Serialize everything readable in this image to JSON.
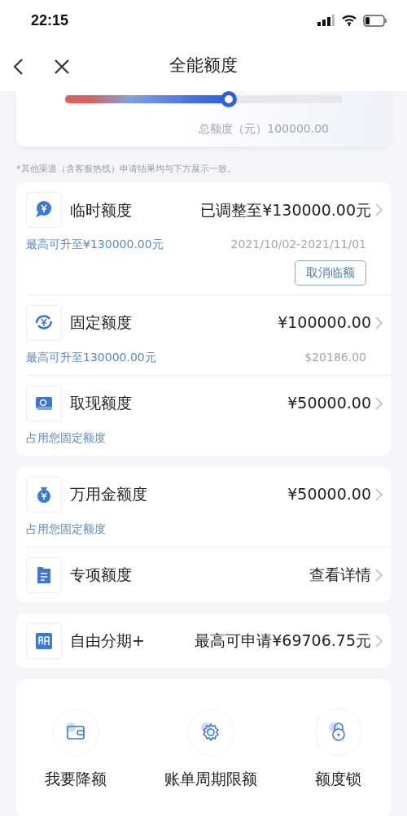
{
  "status_bar": {
    "time": "22:15"
  },
  "nav": {
    "title": "全能额度"
  },
  "total_slider": {
    "level": 0.59,
    "caption": "总额度（元）100000.00"
  },
  "notice": "*其他渠道（含客服热线）申请结果均与下方展示一致。",
  "groups": [
    {
      "rows": [
        {
          "title": "临时额度",
          "value": "已调整至¥130000.00元",
          "sub": "最高可升至¥130000.00元",
          "note": "2021/10/02-2021/11/01",
          "button": "取消临额"
        },
        {
          "title": "固定额度",
          "value": "¥100000.00",
          "sub": "最高可升至130000.00元",
          "note": "$20186.00"
        },
        {
          "title": "取现额度",
          "value": "¥50000.00",
          "sub": "占用您固定额度"
        }
      ]
    },
    {
      "rows": [
        {
          "title": "万用金额度",
          "value": "¥50000.00",
          "sub": "占用您固定额度"
        },
        {
          "title": "专项额度",
          "value": "查看详情"
        }
      ]
    },
    {
      "rows": [
        {
          "title": "自由分期+",
          "value": "最高可申请¥69706.75元"
        }
      ]
    }
  ],
  "actions": [
    {
      "label": "我要降额"
    },
    {
      "label": "账单周期限额"
    },
    {
      "label": "额度锁"
    }
  ]
}
